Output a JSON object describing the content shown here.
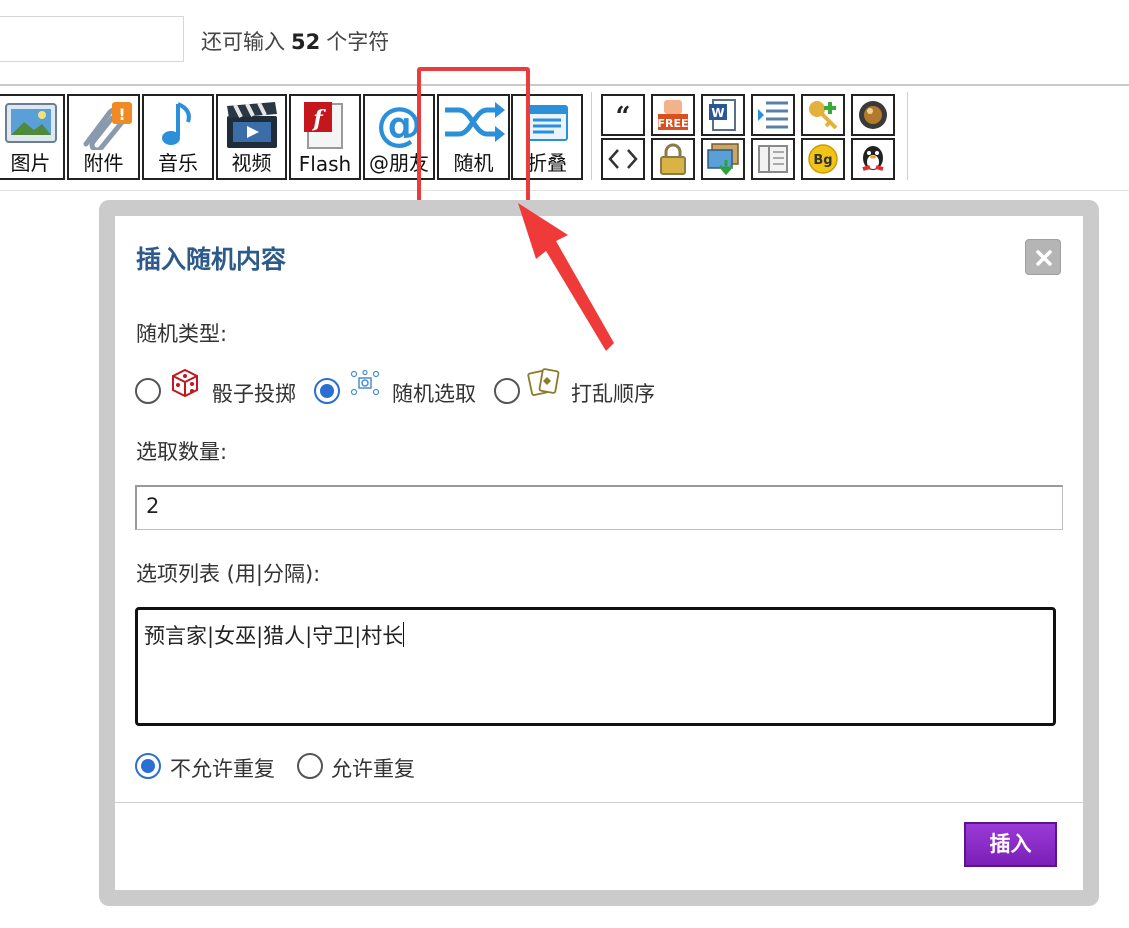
{
  "editor": {
    "title_input_value": "",
    "char_counter_prefix": "还可输入",
    "char_counter_count": "52",
    "char_counter_suffix": "个字符"
  },
  "toolbar": {
    "buttons": [
      {
        "label": "图片",
        "icon": "image-icon"
      },
      {
        "label": "附件",
        "icon": "paperclip-icon"
      },
      {
        "label": "音乐",
        "icon": "music-note-icon"
      },
      {
        "label": "视频",
        "icon": "clapperboard-icon"
      },
      {
        "label": "Flash",
        "icon": "flash-icon"
      },
      {
        "label": "@朋友",
        "icon": "at-sign-icon"
      },
      {
        "label": "随机",
        "icon": "shuffle-icon"
      },
      {
        "label": "折叠",
        "icon": "collapse-icon"
      }
    ],
    "small_buttons": [
      {
        "icon": "quote-icon"
      },
      {
        "icon": "free-tag-icon"
      },
      {
        "icon": "word-doc-icon"
      },
      {
        "icon": "list-indent-icon"
      },
      {
        "icon": "key-add-icon"
      },
      {
        "icon": "sphere-icon"
      },
      {
        "icon": "code-icon"
      },
      {
        "icon": "lock-icon"
      },
      {
        "icon": "image-download-icon"
      },
      {
        "icon": "columns-icon"
      },
      {
        "icon": "bg-color-icon"
      },
      {
        "icon": "qq-penguin-icon"
      }
    ],
    "highlight_color": "#ec3b3b"
  },
  "dialog": {
    "title": "插入随机内容",
    "random_type_label": "随机类型:",
    "random_types": [
      {
        "label": "骰子投掷",
        "icon": "dice-icon",
        "selected": false
      },
      {
        "label": "随机选取",
        "icon": "random-pick-icon",
        "selected": true
      },
      {
        "label": "打乱顺序",
        "icon": "cards-shuffle-icon",
        "selected": false
      }
    ],
    "count_label": "选取数量:",
    "count_value": "2",
    "options_label": "选项列表 (用|分隔):",
    "options_value": "预言家|女巫|猎人|守卫|村长",
    "repeat_options": [
      {
        "label": "不允许重复",
        "selected": true
      },
      {
        "label": "允许重复",
        "selected": false
      }
    ],
    "insert_label": "插入",
    "title_color": "#2d5a8a",
    "accent_color": "#2a6fd1",
    "insert_color": "#8a2cc8"
  }
}
